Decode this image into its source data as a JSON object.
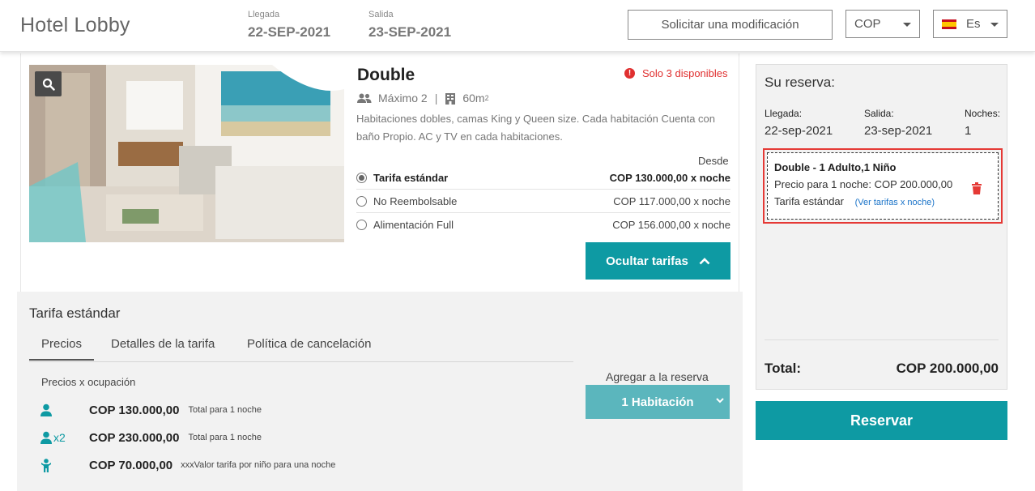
{
  "header": {
    "brand": "Hotel Lobby",
    "checkin_label": "Llegada",
    "checkin_value": "22-SEP-2021",
    "checkout_label": "Salida",
    "checkout_value": "23-SEP-2021",
    "modify_button": "Solicitar una modificación",
    "currency": "COP",
    "language": "Es"
  },
  "room": {
    "name": "Double",
    "availability": "Solo 3 disponibles",
    "max_guests": "Máximo 2",
    "size": "60m",
    "size_sup": "2",
    "description": "Habitaciones dobles, camas King y Queen size. Cada habitación Cuenta con baño Propio. AC y TV en cada habitaciones.",
    "from_label": "Desde",
    "rates": [
      {
        "name": "Tarifa estándar",
        "price": "COP 130.000,00 x noche",
        "selected": true
      },
      {
        "name": "No Reembolsable",
        "price": "COP 117.000,00 x noche",
        "selected": false
      },
      {
        "name": "Alimentación Full",
        "price": "COP 156.000,00 x noche",
        "selected": false
      }
    ],
    "hide_rates_button": "Ocultar tarifas"
  },
  "detail": {
    "title": "Tarifa estándar",
    "tabs": [
      "Precios",
      "Detalles de la tarifa",
      "Política de cancelación"
    ],
    "occupancy_label": "Precios x ocupación",
    "occupancy": [
      {
        "icon": "person-icon",
        "mult": "",
        "amount": "COP 130.000,00",
        "note": "Total para 1 noche"
      },
      {
        "icon": "person-icon",
        "mult": "x2",
        "amount": "COP 230.000,00",
        "note": "Total para 1 noche"
      },
      {
        "icon": "child-icon",
        "mult": "",
        "amount": "COP 70.000,00",
        "note": "xxxValor tarifa por niño para una noche"
      }
    ],
    "add_label": "Agregar a la reserva",
    "add_select": "1 Habitación"
  },
  "reservation": {
    "title": "Su reserva:",
    "checkin_label": "Llegada:",
    "checkin_value": "22-sep-2021",
    "checkout_label": "Salida:",
    "checkout_value": "23-sep-2021",
    "nights_label": "Noches:",
    "nights_value": "1",
    "item_title": "Double - 1 Adulto,1 Niño",
    "item_price": "Precio para 1 noche: COP 200.000,00",
    "item_rate": "Tarifa estándar",
    "item_link": "(Ver tarifas x noche)",
    "total_label": "Total:",
    "total_value": "COP 200.000,00",
    "reserve_button": "Reservar"
  },
  "colors": {
    "accent": "#0e9aa3",
    "accent_light": "#5bb6bd",
    "alert": "#e03030"
  }
}
